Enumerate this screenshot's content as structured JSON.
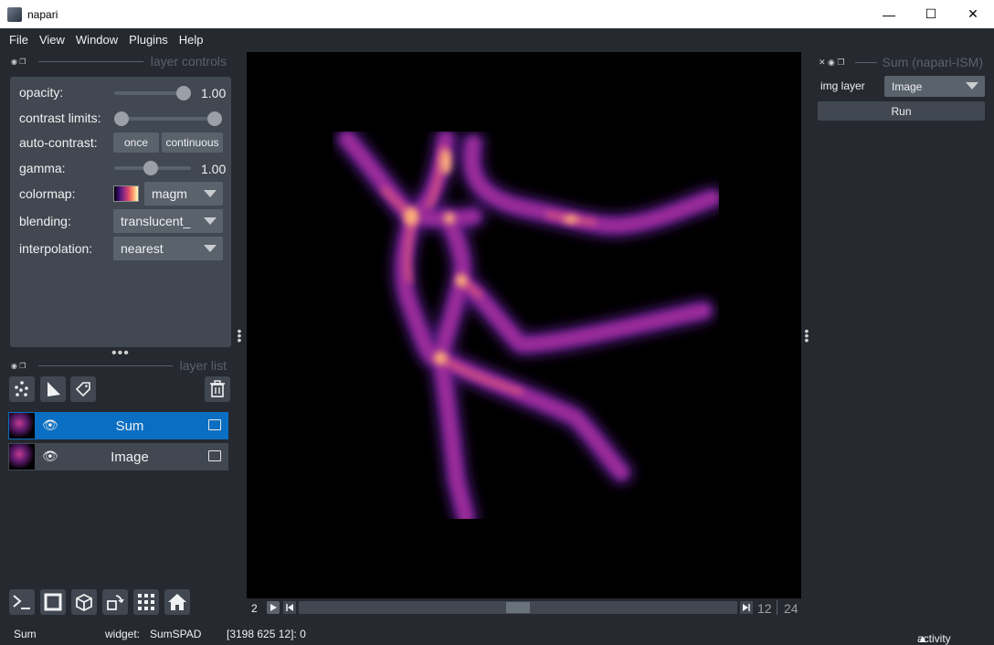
{
  "window": {
    "title": "napari"
  },
  "menu": [
    "File",
    "View",
    "Window",
    "Plugins",
    "Help"
  ],
  "layer_controls": {
    "title": "layer controls",
    "opacity_label": "opacity:",
    "opacity_value": "1.00",
    "contrast_label": "contrast limits:",
    "autocontrast_label": "auto-contrast:",
    "once_label": "once",
    "continuous_label": "continuous",
    "gamma_label": "gamma:",
    "gamma_value": "1.00",
    "colormap_label": "colormap:",
    "colormap_value": "magm",
    "blending_label": "blending:",
    "blending_value": "translucent_",
    "interpolation_label": "interpolation:",
    "interpolation_value": "nearest",
    "opacity_level": 1.0,
    "gamma_level": 0.5
  },
  "layer_list": {
    "title": "layer list",
    "layers": [
      {
        "name": "Sum",
        "selected": true
      },
      {
        "name": "Image",
        "selected": false
      }
    ]
  },
  "plugin": {
    "title": "Sum (napari-ISM)",
    "img_layer_label": "img layer",
    "img_layer_value": "Image",
    "run_label": "Run"
  },
  "dims": {
    "axis_label": "2",
    "current": "12",
    "total": "24",
    "position_fraction": 0.5
  },
  "status": {
    "layer": "Sum",
    "widget_label": "widget:",
    "widget_name": "SumSPAD",
    "coords": "[3198 625 12]: 0",
    "activity": "activity"
  },
  "colors": {
    "background": "#262930",
    "panel": "#414851",
    "control": "#5a626c",
    "selected": "#0a6fc2",
    "text": "#f0f1f2"
  }
}
